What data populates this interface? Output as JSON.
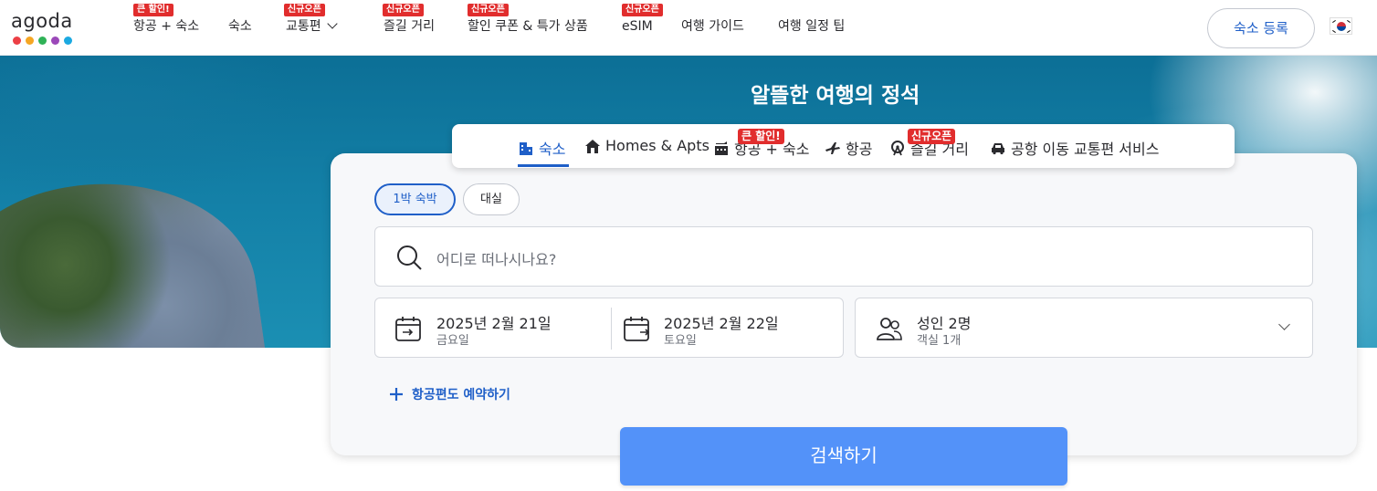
{
  "brand": {
    "name": "agoda",
    "dot_colors": [
      "#ec3f45",
      "#f5a623",
      "#2fb257",
      "#9b48b9",
      "#1ba9e1"
    ]
  },
  "nav": {
    "items": [
      {
        "label": "항공 + 숙소",
        "badge": "큰 할인!"
      },
      {
        "label": "숙소",
        "badge": ""
      },
      {
        "label": "교통편",
        "badge": "신규오픈"
      },
      {
        "label": "즐길 거리",
        "badge": "신규오픈"
      },
      {
        "label": "할인 쿠폰 & 특가 상품",
        "badge": "신규오픈"
      },
      {
        "label": "eSIM",
        "badge": "신규오픈"
      },
      {
        "label": "여행 가이드",
        "badge": ""
      },
      {
        "label": "여행 일정 팁",
        "badge": ""
      }
    ],
    "register_label": "숙소 등록",
    "language_flag": "korea-flag-icon"
  },
  "hero": {
    "title": "알뜰한 여행의 정석"
  },
  "tabs": [
    {
      "label": "숙소",
      "icon": "hotel-icon",
      "active": true,
      "badge": ""
    },
    {
      "label": "Homes & Apts",
      "icon": "home-icon",
      "active": false,
      "badge": ""
    },
    {
      "label": "항공 + 숙소",
      "icon": "flight-hotel-icon",
      "active": false,
      "badge": "큰 할인!"
    },
    {
      "label": "항공",
      "icon": "airplane-icon",
      "active": false,
      "badge": ""
    },
    {
      "label": "즐길 거리",
      "icon": "ferris-wheel-icon",
      "active": false,
      "badge": "신규오픈"
    },
    {
      "label": "공항 이동 교통편 서비스",
      "icon": "car-icon",
      "active": false,
      "badge": ""
    }
  ],
  "search": {
    "stay_types": [
      {
        "label": "1박 숙박",
        "selected": true
      },
      {
        "label": "대실",
        "selected": false
      }
    ],
    "destination_placeholder": "어디로 떠나시나요?",
    "checkin": {
      "date": "2025년 2월 21일",
      "weekday": "금요일"
    },
    "checkout": {
      "date": "2025년 2월 22일",
      "weekday": "토요일"
    },
    "guests": {
      "main": "성인 2명",
      "sub": "객실 1개"
    },
    "add_flight_label": "항공편도 예약하기",
    "submit_label": "검색하기"
  },
  "colors": {
    "accent": "#1f5fc8",
    "search_button": "#5392f9",
    "badge": "#e12d2d"
  }
}
